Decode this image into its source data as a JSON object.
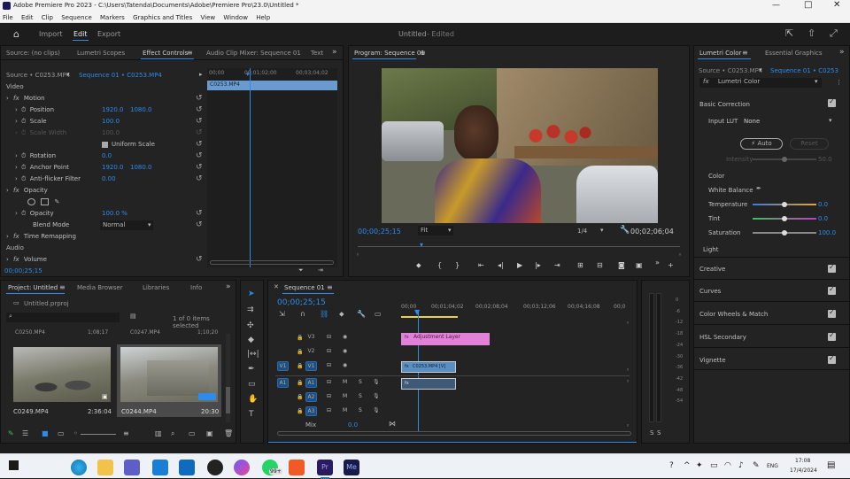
{
  "app": {
    "title": "Adobe Premiere Pro 2023 - C:\\Users\\Tatenda\\Documents\\Adobe\\Premiere Pro\\23.0\\Untitled *",
    "menus": [
      "File",
      "Edit",
      "Clip",
      "Sequence",
      "Markers",
      "Graphics and Titles",
      "View",
      "Window",
      "Help"
    ],
    "workspace_tabs": [
      "Import",
      "Edit",
      "Export"
    ],
    "doc_title": "Untitled",
    "doc_status": "- Edited"
  },
  "source_panel": {
    "tabs": [
      "Source: (no clips)",
      "Lumetri Scopes",
      "Effect Controls",
      "Audio Clip Mixer: Sequence 01",
      "Text"
    ],
    "source_clip": "Source • C0253.MP4",
    "sequence_clip": "Sequence 01 • C0253.MP4",
    "ruler": [
      "00;00",
      "00;01;02;00",
      "00;03;04;02"
    ],
    "clip_label": "C0253.MP4",
    "video_header": "Video",
    "motion": "Motion",
    "position_label": "Position",
    "position_x": "1920.0",
    "position_y": "1080.0",
    "scale_label": "Scale",
    "scale_value": "100.0",
    "scale_width_label": "Scale Width",
    "scale_width_value": "100.0",
    "uniform_scale": "Uniform Scale",
    "rotation_label": "Rotation",
    "rotation_value": "0.0",
    "anchor_label": "Anchor Point",
    "anchor_x": "1920.0",
    "anchor_y": "1080.0",
    "antiflicker_label": "Anti-flicker Filter",
    "antiflicker_value": "0.00",
    "opacity_header": "Opacity",
    "opacity_label": "Opacity",
    "opacity_value": "100.0 %",
    "blend_label": "Blend Mode",
    "blend_value": "Normal",
    "time_remap": "Time Remapping",
    "audio_header": "Audio",
    "volume": "Volume",
    "timecode": "00;00;25;15"
  },
  "program_panel": {
    "title": "Program: Sequence 01",
    "timecode": "00;00;25;15",
    "fit": "Fit",
    "ratio": "1/4",
    "duration": "00;02;06;04"
  },
  "lumetri": {
    "tabs": [
      "Lumetri Color",
      "Essential Graphics"
    ],
    "source": "Source • C0253.MP4",
    "sequence": "Sequence 01 • C0253",
    "effect": "Lumetri Color",
    "basic_correction": "Basic Correction",
    "input_lut_label": "Input LUT",
    "input_lut_value": "None",
    "auto_btn": "Auto",
    "reset_btn": "Reset",
    "intensity": "Intensity",
    "intensity_value": "50.0",
    "color": "Color",
    "white_balance": "White Balance",
    "temperature": "Temperature",
    "temperature_value": "0.0",
    "tint": "Tint",
    "tint_value": "0.0",
    "saturation": "Saturation",
    "saturation_value": "100.0",
    "light": "Light",
    "sections": [
      "Creative",
      "Curves",
      "Color Wheels & Match",
      "HSL Secondary",
      "Vignette"
    ]
  },
  "project_panel": {
    "tabs": [
      "Project: Untitled",
      "Media Browser",
      "Libraries",
      "Info"
    ],
    "project_name": "Untitled.prproj",
    "items_selected": "1 of 0 items selected",
    "top_row": [
      {
        "name": "C0250.MP4",
        "duration": "1;08;17"
      },
      {
        "name": "C0247.MP4",
        "duration": "1;10;20"
      }
    ],
    "clips": [
      {
        "name": "C0249.MP4",
        "duration": "2:36:04"
      },
      {
        "name": "C0244.MP4",
        "duration": "20:30"
      }
    ]
  },
  "timeline": {
    "tab": "Sequence 01",
    "timecode": "00;00;25;15",
    "ruler": [
      "00;00",
      "00;01;04;02",
      "00;02;08;04",
      "00;03;12;06",
      "00;04;16;08",
      "00;0"
    ],
    "video_tracks": [
      "V3",
      "V2",
      "V1"
    ],
    "audio_tracks": [
      "A1",
      "A2",
      "A3"
    ],
    "adjustment_clip": "Adjustment Layer",
    "video_clip": "C0253.MP4 [V]",
    "mix_label": "Mix",
    "mix_value": "0.0",
    "meter_scale": [
      "0",
      "-6",
      "-12",
      "-18",
      "-24",
      "-30",
      "-36",
      "-42",
      "-48",
      "-54"
    ],
    "meter_bottom": [
      "S",
      "S"
    ]
  },
  "taskbar": {
    "notification_count": "99+",
    "lang": "ENG",
    "time": "17:08",
    "date": "17/4/2024",
    "pr_label": "Pr",
    "me_label": "Me"
  },
  "colors": {
    "accent": "#2d8ceb",
    "adjustment_clip": "#e281d8",
    "video_clip": "#5a8fc4",
    "temperature_grad": [
      "#3a7bd5",
      "#e6a23c"
    ],
    "tint_grad": [
      "#3fbf5a",
      "#c03fc0"
    ]
  }
}
